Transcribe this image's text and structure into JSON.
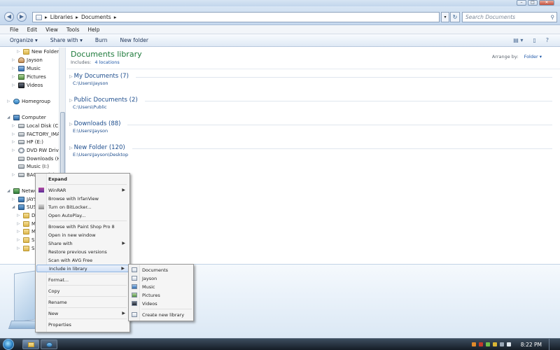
{
  "window": {
    "title_controls": {
      "minimize": "–",
      "maximize": "□",
      "close": "✕"
    }
  },
  "address": {
    "back_icon": "back-arrow-icon",
    "crumbs": [
      "Libraries",
      "Documents"
    ],
    "separator": "▸",
    "search_placeholder": "Search Documents"
  },
  "menubar": {
    "items": [
      "File",
      "Edit",
      "View",
      "Tools",
      "Help"
    ]
  },
  "toolbar": {
    "organize": "Organize ▾",
    "share_with": "Share with ▾",
    "burn": "Burn",
    "new_folder": "New folder"
  },
  "navpane": {
    "items": [
      {
        "label": "New Folder (E:)",
        "icon": "folder-icon",
        "indent": 2,
        "arrow": "▷"
      },
      {
        "label": "Jayson",
        "icon": "person-icon",
        "indent": 1,
        "arrow": "▷"
      },
      {
        "label": "Music",
        "icon": "music-icon",
        "indent": 1,
        "arrow": "▷"
      },
      {
        "label": "Pictures",
        "icon": "pictures-icon",
        "indent": 1,
        "arrow": "▷"
      },
      {
        "label": "Videos",
        "icon": "videos-icon",
        "indent": 1,
        "arrow": "▷"
      },
      {
        "label": "Homegroup",
        "icon": "homegroup-icon",
        "indent": 0,
        "arrow": "▷"
      },
      {
        "label": "Computer",
        "icon": "computer-icon",
        "indent": 0,
        "arrow": "◢"
      },
      {
        "label": "Local Disk (C:)",
        "icon": "drive-icon",
        "indent": 1,
        "arrow": "▷"
      },
      {
        "label": "FACTORY_IMAGE",
        "icon": "drive-icon",
        "indent": 1,
        "arrow": "▷"
      },
      {
        "label": "HP (E:)",
        "icon": "drive-icon",
        "indent": 1,
        "arrow": "▷"
      },
      {
        "label": "DVD RW Drive (F:)",
        "icon": "dvd-icon",
        "indent": 1,
        "arrow": "▷"
      },
      {
        "label": "Downloads (H:)",
        "icon": "drive-icon",
        "indent": 1,
        "arrow": ""
      },
      {
        "label": "Music (I:)",
        "icon": "drive-icon",
        "indent": 1,
        "arrow": ""
      },
      {
        "label": "BACKUP (J:)",
        "icon": "drive-icon",
        "indent": 1,
        "arrow": "▷"
      },
      {
        "label": "Network",
        "icon": "network-icon",
        "indent": 0,
        "arrow": "◢"
      },
      {
        "label": "JAYSON",
        "icon": "computer-icon",
        "indent": 1,
        "arrow": "▷"
      },
      {
        "label": "SUSAN",
        "icon": "computer-icon",
        "indent": 1,
        "arrow": "◢"
      },
      {
        "label": "Data",
        "icon": "folder-icon",
        "indent": 2,
        "arrow": "▷"
      },
      {
        "label": "Music",
        "icon": "folder-icon",
        "indent": 2,
        "arrow": "▷"
      },
      {
        "label": "My",
        "icon": "folder-icon",
        "indent": 2,
        "arrow": "▷"
      },
      {
        "label": "Shared",
        "icon": "folder-icon",
        "indent": 2,
        "arrow": "▷"
      },
      {
        "label": "Susan",
        "icon": "folder-icon",
        "indent": 2,
        "arrow": "▷"
      }
    ]
  },
  "content": {
    "title": "Documents library",
    "includes_label": "Includes:",
    "includes_link": "4 locations",
    "arrange_label": "Arrange by:",
    "arrange_value": "Folder ▾",
    "groups": [
      {
        "name": "My Documents (7)",
        "path": "C:\\Users\\Jayson"
      },
      {
        "name": "Public Documents (2)",
        "path": "C:\\Users\\Public"
      },
      {
        "name": "Downloads (88)",
        "path": "E:\\Users\\Jayson"
      },
      {
        "name": "New Folder (120)",
        "path": "E:\\Users\\Jayson\\Desktop"
      }
    ]
  },
  "context_menu": {
    "items": [
      {
        "label": "Expand",
        "bold": true,
        "submenu": false,
        "icon": ""
      },
      {
        "sep": true
      },
      {
        "label": "WinRAR",
        "submenu": true,
        "icon": "winrar-icon"
      },
      {
        "label": "Browse with IrfanView",
        "submenu": false,
        "icon": ""
      },
      {
        "label": "Turn on BitLocker...",
        "submenu": false,
        "icon": "bitlocker-icon"
      },
      {
        "label": "Open AutoPlay...",
        "submenu": false,
        "icon": ""
      },
      {
        "sep": true
      },
      {
        "label": "Browse with Paint Shop Pro 8",
        "submenu": false,
        "icon": ""
      },
      {
        "label": "Open in new window",
        "submenu": false,
        "icon": ""
      },
      {
        "label": "Share with",
        "submenu": true,
        "icon": ""
      },
      {
        "label": "Restore previous versions",
        "submenu": false,
        "icon": ""
      },
      {
        "label": "Scan with AVG Free",
        "submenu": false,
        "icon": ""
      },
      {
        "label": "Include in library",
        "submenu": true,
        "icon": "",
        "highlight": true
      },
      {
        "sep": true
      },
      {
        "label": "Format...",
        "submenu": false,
        "icon": ""
      },
      {
        "sep": true
      },
      {
        "label": "Copy",
        "submenu": false,
        "icon": ""
      },
      {
        "sep": true
      },
      {
        "label": "Rename",
        "submenu": false,
        "icon": ""
      },
      {
        "sep": true
      },
      {
        "label": "New",
        "submenu": true,
        "icon": ""
      },
      {
        "sep": true
      },
      {
        "label": "Properties",
        "submenu": false,
        "icon": ""
      }
    ],
    "submenu_arrow": "▶"
  },
  "library_submenu": {
    "items": [
      {
        "label": "Documents",
        "icon": "documents-library-icon"
      },
      {
        "label": "Jayson",
        "icon": "jayson-library-icon"
      },
      {
        "label": "Music",
        "icon": "music-library-icon"
      },
      {
        "label": "Pictures",
        "icon": "pictures-library-icon"
      },
      {
        "label": "Videos",
        "icon": "videos-library-icon"
      },
      {
        "sep": true
      },
      {
        "label": "Create new library",
        "icon": "new-library-icon"
      }
    ]
  },
  "taskbar": {
    "clock": "8:22 PM",
    "apps": [
      "explorer-icon",
      "ie-icon"
    ]
  },
  "colors": {
    "library_title": "#1e7a3b",
    "link_blue": "#1d57a8",
    "menu_highlight": "#cfe0f6"
  }
}
